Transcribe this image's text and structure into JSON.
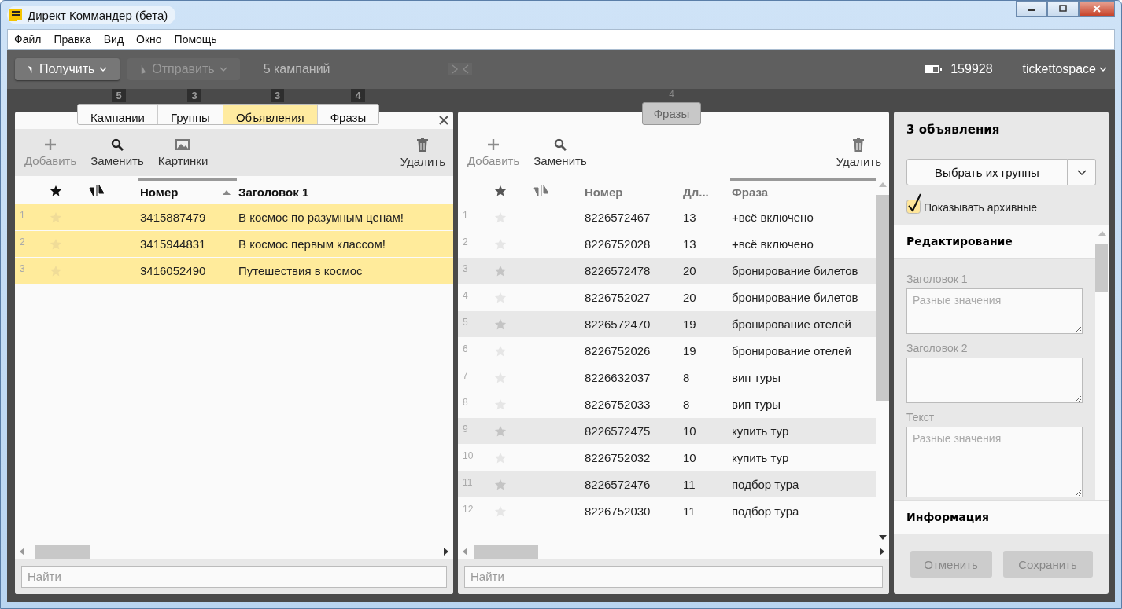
{
  "window": {
    "title": "Директ Коммандер (бета)"
  },
  "menu": [
    "Файл",
    "Правка",
    "Вид",
    "Окно",
    "Помощь"
  ],
  "toolbar": {
    "get_button": {
      "label": "Получить",
      "disabled": false
    },
    "send_button": {
      "label": "Отправить",
      "disabled": true
    },
    "campaigns_count": "5 кампаний",
    "balance": "159928",
    "account": "tickettospace"
  },
  "left_tabs": [
    {
      "label": "Кампании",
      "count": "5",
      "selected": false
    },
    {
      "label": "Группы",
      "count": "3",
      "selected": false
    },
    {
      "label": "Объявления",
      "count": "3",
      "selected": true
    },
    {
      "label": "Фразы",
      "count": "4",
      "selected": false
    }
  ],
  "left_panel": {
    "actions": [
      {
        "kind": "add",
        "label": "Добавить",
        "disabled": true
      },
      {
        "kind": "replace",
        "label": "Заменить",
        "disabled": false
      },
      {
        "kind": "images",
        "label": "Картинки",
        "disabled": false
      },
      {
        "kind": "delete",
        "label": "Удалить",
        "disabled": false
      }
    ],
    "columns": [
      {
        "label": "Номер",
        "sorted": true
      },
      {
        "label": "Заголовок 1",
        "sorted": false
      }
    ],
    "rows": [
      {
        "index": "1",
        "number": "3415887479",
        "title": "В космос по разумным ценам!",
        "selected": true
      },
      {
        "index": "2",
        "number": "3415944831",
        "title": "В космос первым классом!",
        "selected": true
      },
      {
        "index": "3",
        "number": "3416052490",
        "title": "Путешествия в космос",
        "selected": true
      }
    ],
    "search": {
      "placeholder": "Найти"
    }
  },
  "middle_tab": {
    "label": "Фразы",
    "count": "4"
  },
  "middle_panel": {
    "actions": [
      {
        "kind": "add",
        "label": "Добавить",
        "disabled": true
      },
      {
        "kind": "replace",
        "label": "Заменить",
        "disabled": false
      },
      {
        "kind": "delete",
        "label": "Удалить",
        "disabled": false
      }
    ],
    "columns": [
      {
        "label": "Номер",
        "sorted": false
      },
      {
        "label": "Дл...",
        "sorted": false
      },
      {
        "label": "Фраза",
        "sorted": true
      }
    ],
    "rows": [
      {
        "index": "1",
        "number": "8226572467",
        "length": "13",
        "phrase": "+всё включено",
        "highlighted": false
      },
      {
        "index": "2",
        "number": "8226752028",
        "length": "13",
        "phrase": "+всё включено",
        "highlighted": false
      },
      {
        "index": "3",
        "number": "8226572478",
        "length": "20",
        "phrase": "бронирование билетов",
        "highlighted": true
      },
      {
        "index": "4",
        "number": "8226752027",
        "length": "20",
        "phrase": "бронирование билетов",
        "highlighted": false
      },
      {
        "index": "5",
        "number": "8226572470",
        "length": "19",
        "phrase": "бронирование отелей",
        "highlighted": true
      },
      {
        "index": "6",
        "number": "8226752026",
        "length": "19",
        "phrase": "бронирование отелей",
        "highlighted": false
      },
      {
        "index": "7",
        "number": "8226632037",
        "length": "8",
        "phrase": "вип туры",
        "highlighted": false
      },
      {
        "index": "8",
        "number": "8226752033",
        "length": "8",
        "phrase": "вип туры",
        "highlighted": false
      },
      {
        "index": "9",
        "number": "8226572475",
        "length": "10",
        "phrase": "купить тур",
        "highlighted": true
      },
      {
        "index": "10",
        "number": "8226752032",
        "length": "10",
        "phrase": "купить тур",
        "highlighted": false
      },
      {
        "index": "11",
        "number": "8226572476",
        "length": "11",
        "phrase": "подбор тура",
        "highlighted": true
      },
      {
        "index": "12",
        "number": "8226752030",
        "length": "11",
        "phrase": "подбор тура",
        "highlighted": false
      }
    ],
    "search": {
      "placeholder": "Найти"
    }
  },
  "right_panel": {
    "title": "3 объявления",
    "choose_button": "Выбрать их группы",
    "show_archived": {
      "label": "Показывать архивные",
      "checked": true
    },
    "editing": {
      "title": "Редактирование",
      "fields": [
        {
          "label": "Заголовок 1",
          "placeholder": "Разные значения"
        },
        {
          "label": "Заголовок 2"
        },
        {
          "label": "Текст",
          "placeholder": "Разные значения"
        }
      ]
    },
    "info": {
      "title": "Информация"
    },
    "buttons": [
      {
        "label": "Отменить",
        "disabled": true
      },
      {
        "label": "Сохранить",
        "disabled": true
      }
    ]
  }
}
